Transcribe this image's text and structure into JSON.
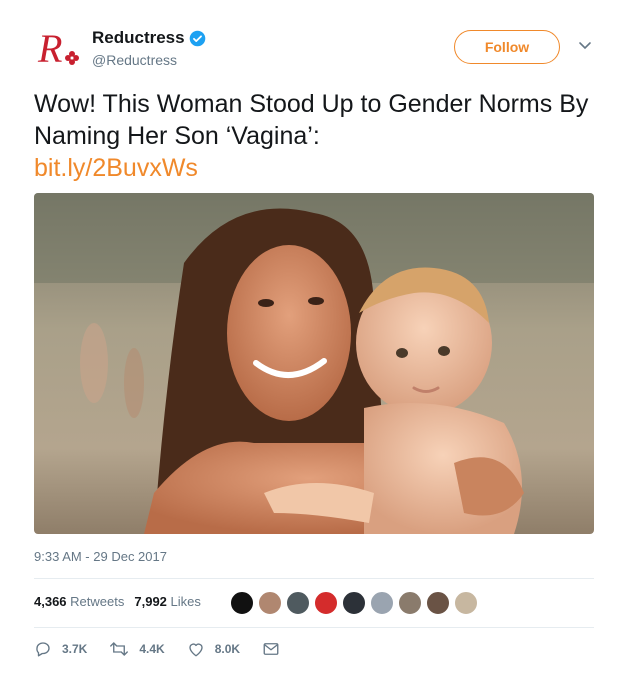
{
  "account": {
    "name": "Reductress",
    "handle": "@Reductress",
    "verified": true,
    "brand_color": "#c8202f"
  },
  "follow_button": {
    "label": "Follow",
    "color": "#f0892b"
  },
  "tweet": {
    "text": "Wow! This Woman Stood Up to Gender Norms By Naming Her Son ‘Vagina’:",
    "link": "bit.ly/2BuvxWs",
    "timestamp": "9:33 AM - 29 Dec 2017"
  },
  "media": {
    "description_icon": "photo-woman-holding-baby-beach"
  },
  "stats": {
    "retweets_count": "4,366",
    "retweets_label": "Retweets",
    "likes_count": "7,992",
    "likes_label": "Likes"
  },
  "actions": {
    "reply_count": "3.7K",
    "retweet_count": "4.4K",
    "like_count": "8.0K"
  },
  "icons": [
    "verified-badge-icon",
    "chevron-down-icon",
    "reply-icon",
    "retweet-icon",
    "heart-icon",
    "mail-icon"
  ]
}
